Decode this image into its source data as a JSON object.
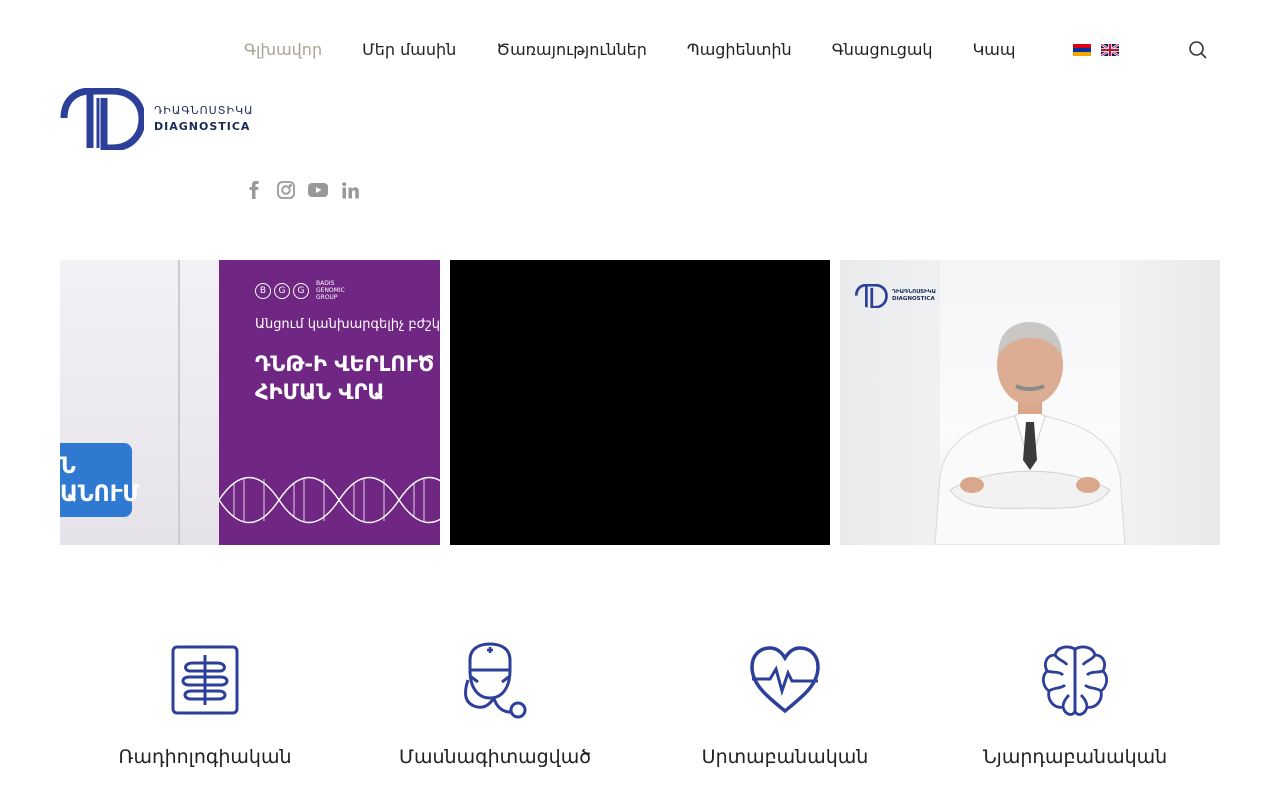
{
  "nav": {
    "items": [
      {
        "label": "Գլխավոր",
        "active": true
      },
      {
        "label": "Մեր մասին",
        "active": false
      },
      {
        "label": "Ծառայություններ",
        "active": false
      },
      {
        "label": "Պացիենտին",
        "active": false
      },
      {
        "label": "Գնացուցակ",
        "active": false
      },
      {
        "label": "Կապ",
        "active": false
      }
    ]
  },
  "languages": [
    "armenian-flag-icon",
    "english-flag-icon"
  ],
  "logo": {
    "line1": "ԴԻԱԳՆՈՍՏԻԿԱ",
    "line2": "DIAGNOSTICA"
  },
  "social": [
    "facebook-icon",
    "instagram-icon",
    "youtube-icon",
    "linkedin-icon"
  ],
  "slides": {
    "slide1": {
      "brand": "BGG",
      "brand_small": "BADIS GENOMIC GROUP",
      "subtitle": "Անցում կանխարգելիչ բժշկությ",
      "headline_1": "ԴՆԹ-Ի ՎԵՐԼՈՒԾ",
      "headline_2": "ՀԻՄԱՆ ՎՐԱ",
      "tag_1": "Ն",
      "tag_2": "ԱՆՈՒՄ"
    },
    "slide3": {
      "logo_line1": "ԴԻԱԳՆՈՍՏԻԿԱ",
      "logo_line2": "DIAGNOSTICA"
    }
  },
  "services": [
    {
      "title": "Ռադիոլոգիական",
      "icon": "radiology-icon"
    },
    {
      "title": "Մասնագիտացված",
      "icon": "doctor-icon"
    },
    {
      "title": "Սրտաբանական",
      "icon": "heart-pulse-icon"
    },
    {
      "title": "Նյարդաբանական",
      "icon": "brain-icon"
    }
  ],
  "colors": {
    "active_nav": "#a8a294",
    "brand_blue": "#2c3f99",
    "purple": "#702683"
  }
}
